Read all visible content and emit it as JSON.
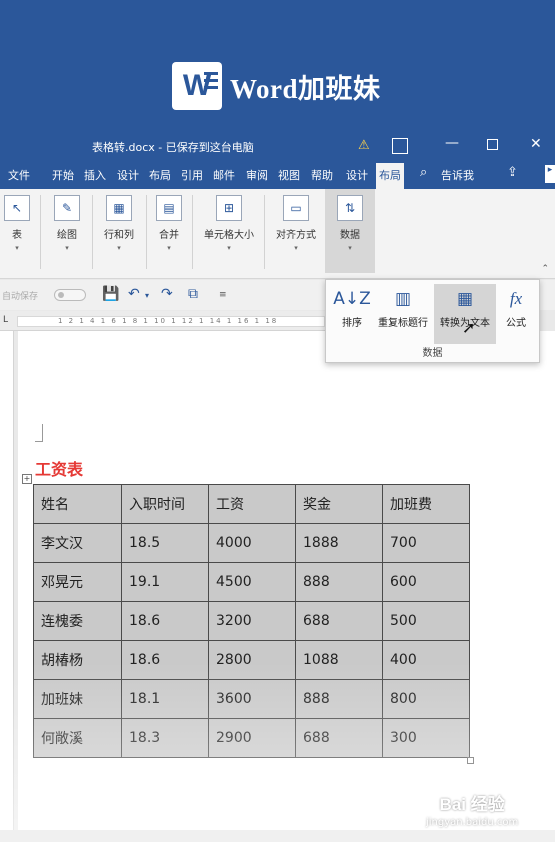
{
  "banner": {
    "logo_letter": "W",
    "brand_name": "Word加班妹"
  },
  "titlebar": {
    "doc_title": "表格转.docx - 已保存到这台电脑",
    "warn_icon": "⚠",
    "minimize": "—",
    "close": "✕"
  },
  "tabs": [
    "文件",
    "开始",
    "插入",
    "设计",
    "布局",
    "引用",
    "邮件",
    "审阅",
    "视图",
    "帮助",
    "设计",
    "布局"
  ],
  "active_tab_index": 11,
  "tell_me": "告诉我",
  "icons": {
    "search": "search-icon",
    "share": "share-icon"
  },
  "ribbon": {
    "groups": [
      {
        "label": "表",
        "icon": "↖"
      },
      {
        "label": "绘图",
        "icon": "✎"
      },
      {
        "label": "行和列",
        "icon": "▦"
      },
      {
        "label": "合并",
        "icon": "▤"
      },
      {
        "label": "单元格大小",
        "icon": "⊞"
      },
      {
        "label": "对齐方式",
        "icon": "▭"
      },
      {
        "label": "数据",
        "icon": "⇅"
      }
    ]
  },
  "qat": {
    "autosave": "自动保存",
    "save_icon": "save-icon",
    "undo_icon": "undo-icon",
    "redo_icon": "redo-icon"
  },
  "data_panel": {
    "items": [
      {
        "label": "排序",
        "icon": "A↓Z"
      },
      {
        "label": "重复标题行",
        "icon": "▥"
      },
      {
        "label": "转换为文本",
        "icon": "▦"
      },
      {
        "label": "公式",
        "icon": "fx"
      }
    ],
    "group_label": "数据"
  },
  "ruler": {
    "corner": "L",
    "numbers": "1 2 1 4 1 6 1 8 1 10 1 12 1 14 1 16 1 18"
  },
  "document": {
    "title": "工资表",
    "header": [
      "姓名",
      "入职时间",
      "工资",
      "奖金",
      "加班费"
    ],
    "rows": [
      [
        "李文汉",
        "18.5",
        "4000",
        "1888",
        "700"
      ],
      [
        "邓晃元",
        "19.1",
        "4500",
        "888",
        "600"
      ],
      [
        "连槐委",
        "18.6",
        "3200",
        "688",
        "500"
      ],
      [
        "胡椿杨",
        "18.6",
        "2800",
        "1088",
        "400"
      ],
      [
        "加班妹",
        "18.1",
        "3600",
        "888",
        "800"
      ],
      [
        "何敞溪",
        "18.3",
        "2900",
        "688",
        "300"
      ]
    ]
  },
  "watermark": {
    "brand": "Bai 经验",
    "url": "jingyan.baidu.com"
  },
  "colors": {
    "word_blue": "#2b579a",
    "title_red": "#e53935",
    "table_gray": "#c9c9c9"
  }
}
